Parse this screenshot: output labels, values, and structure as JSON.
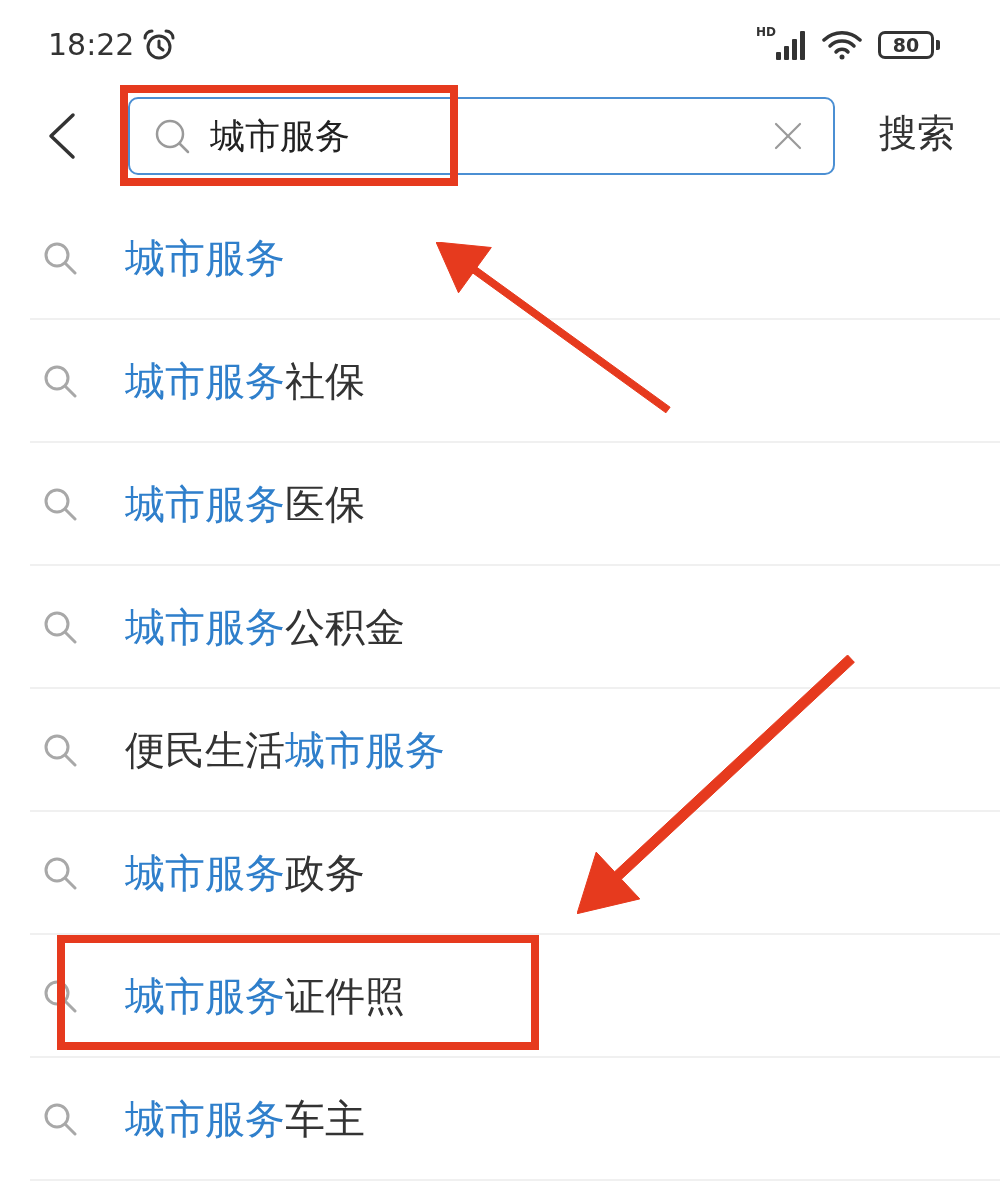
{
  "status_bar": {
    "time": "18:22",
    "network_label": "HD",
    "battery": "80"
  },
  "search_bar": {
    "query": "城市服务",
    "framed": true,
    "action": "搜索"
  },
  "suggestions": [
    {
      "parts": [
        {
          "text": "城市服务",
          "match": true
        }
      ],
      "framed": false
    },
    {
      "parts": [
        {
          "text": "城市服务",
          "match": true
        },
        {
          "text": "社保",
          "match": false
        }
      ],
      "framed": false
    },
    {
      "parts": [
        {
          "text": "城市服务",
          "match": true
        },
        {
          "text": "医保",
          "match": false
        }
      ],
      "framed": false
    },
    {
      "parts": [
        {
          "text": "城市服务",
          "match": true
        },
        {
          "text": "公积金",
          "match": false
        }
      ],
      "framed": false
    },
    {
      "parts": [
        {
          "text": "便民生活",
          "match": false
        },
        {
          "text": "城市服务",
          "match": true
        }
      ],
      "framed": false
    },
    {
      "parts": [
        {
          "text": "城市服务",
          "match": true
        },
        {
          "text": "政务",
          "match": false
        }
      ],
      "framed": false
    },
    {
      "parts": [
        {
          "text": "城市服务",
          "match": true
        },
        {
          "text": "证件照",
          "match": false
        }
      ],
      "framed": true
    },
    {
      "parts": [
        {
          "text": "城市服务",
          "match": true
        },
        {
          "text": "车主",
          "match": false
        }
      ],
      "framed": false
    }
  ]
}
